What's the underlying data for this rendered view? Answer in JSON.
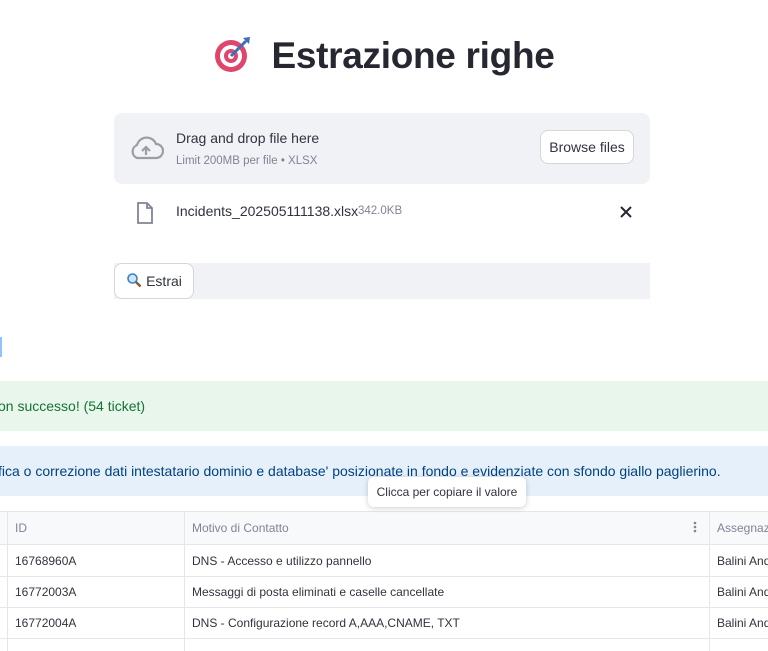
{
  "header": {
    "title": "Estrazione righe",
    "icon": "target-dart-icon"
  },
  "uploader": {
    "drop_text": "Drag and drop file here",
    "limit_text": "Limit 200MB per file • XLSX",
    "browse_label": "Browse files"
  },
  "file": {
    "name": "Incidents_202505111138.xlsx",
    "size": "342.0KB"
  },
  "action": {
    "estrai_label": "Estrai"
  },
  "success": {
    "text": "on successo! (54 ticket)"
  },
  "info": {
    "text": "fica o correzione dati intestatario dominio e database' posizionate in fondo e evidenziate con sfondo giallo paglierino."
  },
  "tooltip": {
    "text": "Clicca per copiare il valore"
  },
  "table": {
    "columns": [
      "ID",
      "Motivo di Contatto",
      "Assegnazi"
    ],
    "rows": [
      [
        "16768960A",
        "DNS - Accesso e utilizzo pannello",
        "Balini And"
      ],
      [
        "16772003A",
        "Messaggi di posta eliminati e caselle cancellate",
        "Balini And"
      ],
      [
        "16772004A",
        "DNS - Configurazione record A,AAA,CNAME, TXT",
        "Balini And"
      ]
    ]
  },
  "colors": {
    "success_bg": "#e8f6ec",
    "success_text": "#177233",
    "info_bg": "#e6f0fb",
    "info_text": "#004280",
    "panel_bg": "#f0f2f6"
  }
}
